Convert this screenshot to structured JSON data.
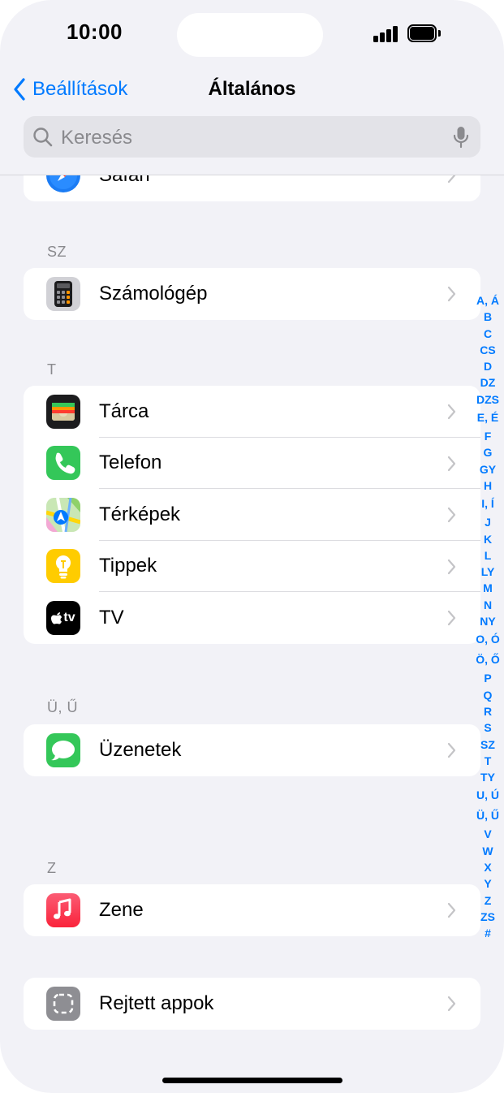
{
  "status_bar": {
    "time": "10:00"
  },
  "nav": {
    "back_label": "Beállítások",
    "title": "Általános"
  },
  "search": {
    "placeholder": "Keresés"
  },
  "partial_row": {
    "label": "Safari"
  },
  "sections": [
    {
      "header": "SZ",
      "items": [
        {
          "label": "Számológép",
          "icon": "calculator-icon"
        }
      ]
    },
    {
      "header": "T",
      "items": [
        {
          "label": "Tárca",
          "icon": "wallet-icon"
        },
        {
          "label": "Telefon",
          "icon": "phone-icon"
        },
        {
          "label": "Térképek",
          "icon": "maps-icon"
        },
        {
          "label": "Tippek",
          "icon": "tips-icon"
        },
        {
          "label": "TV",
          "icon": "apple-tv-icon",
          "icon_text": "tv"
        }
      ]
    },
    {
      "header": "Ü, Ű",
      "items": [
        {
          "label": "Üzenetek",
          "icon": "messages-icon"
        }
      ]
    },
    {
      "header": "Z",
      "items": [
        {
          "label": "Zene",
          "icon": "music-icon"
        }
      ]
    }
  ],
  "hidden_apps": {
    "label": "Rejtett appok",
    "icon": "hidden-apps-icon"
  },
  "index": [
    "A, Á",
    "B",
    "C",
    "CS",
    "D",
    "DZ",
    "DZS",
    "E, É",
    "F",
    "G",
    "GY",
    "H",
    "I, Í",
    "J",
    "K",
    "L",
    "LY",
    "M",
    "N",
    "NY",
    "O, Ó",
    "Ö, Ő",
    "P",
    "Q",
    "R",
    "S",
    "SZ",
    "T",
    "TY",
    "U, Ú",
    "Ü, Ű",
    "V",
    "W",
    "X",
    "Y",
    "Z",
    "ZS",
    "#"
  ],
  "colors": {
    "accent": "#007aff",
    "background": "#f2f2f7",
    "secondary_text": "#8a8a8e"
  }
}
